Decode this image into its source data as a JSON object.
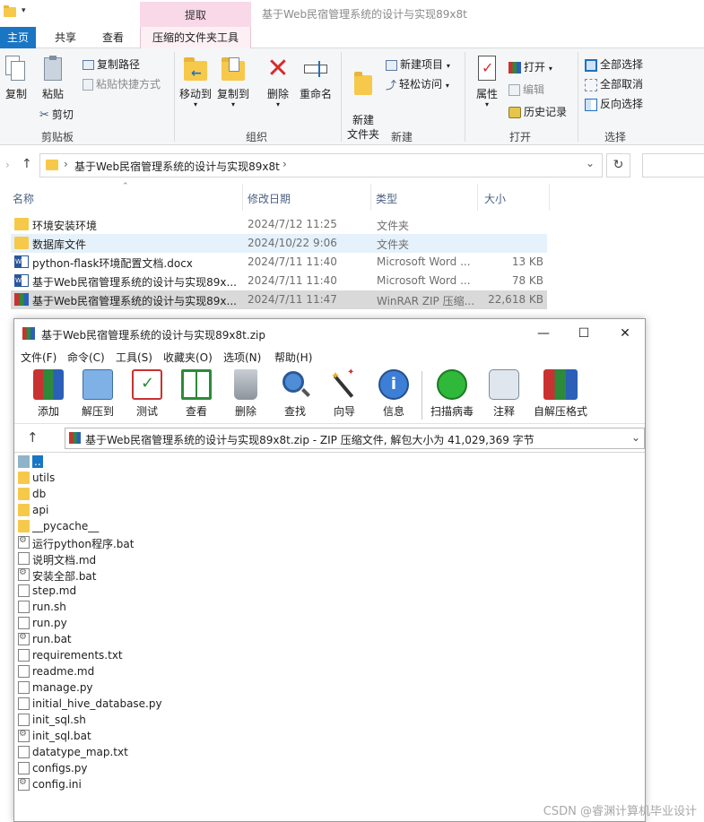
{
  "explorer": {
    "title_context_tab": "提取",
    "window_title": "基于Web民宿管理系统的设计与实现89x8t",
    "tabs": [
      "主页",
      "共享",
      "查看",
      "压缩的文件夹工具"
    ],
    "ribbon": {
      "clipboard": {
        "label": "剪贴板",
        "copy": "复制",
        "paste": "粘贴",
        "copy_path": "复制路径",
        "paste_shortcut": "粘贴快捷方式",
        "cut": "剪切"
      },
      "organize": {
        "label": "组织",
        "move_to": "移动到",
        "copy_to": "复制到",
        "delete": "删除",
        "rename": "重命名"
      },
      "new": {
        "label": "新建",
        "new_folder": "新建\n文件夹",
        "new_item": "新建项目",
        "easy_access": "轻松访问"
      },
      "open": {
        "label": "打开",
        "properties": "属性",
        "open": "打开",
        "edit": "编辑",
        "history": "历史记录"
      },
      "select": {
        "label": "选择",
        "select_all": "全部选择",
        "select_none": "全部取消",
        "invert": "反向选择"
      }
    },
    "address": {
      "path": "基于Web民宿管理系统的设计与实现89x8t"
    },
    "columns": {
      "name": "名称",
      "date": "修改日期",
      "type": "类型",
      "size": "大小"
    },
    "files": [
      {
        "name": "环境安装环境",
        "date": "2024/7/12 11:25",
        "type": "文件夹",
        "size": "",
        "icon": "folder-icon"
      },
      {
        "name": "数据库文件",
        "date": "2024/10/22 9:06",
        "type": "文件夹",
        "size": "",
        "icon": "folder-icon"
      },
      {
        "name": "python-flask环境配置文档.docx",
        "date": "2024/7/11 11:40",
        "type": "Microsoft Word ...",
        "size": "13 KB",
        "icon": "word-icon"
      },
      {
        "name": "基于Web民宿管理系统的设计与实现89x...",
        "date": "2024/7/11 11:40",
        "type": "Microsoft Word ...",
        "size": "78 KB",
        "icon": "word-icon"
      },
      {
        "name": "基于Web民宿管理系统的设计与实现89x...",
        "date": "2024/7/11 11:47",
        "type": "WinRAR ZIP 压缩...",
        "size": "22,618 KB",
        "icon": "winrar-icon"
      }
    ]
  },
  "winrar": {
    "title": "基于Web民宿管理系统的设计与实现89x8t.zip",
    "menu": [
      "文件(F)",
      "命令(C)",
      "工具(S)",
      "收藏夹(O)",
      "选项(N)",
      "帮助(H)"
    ],
    "tools": [
      "添加",
      "解压到",
      "测试",
      "查看",
      "删除",
      "查找",
      "向导",
      "信息",
      "扫描病毒",
      "注释",
      "自解压格式"
    ],
    "path": "基于Web民宿管理系统的设计与实现89x8t.zip - ZIP 压缩文件, 解包大小为 41,029,369 字节",
    "items": [
      {
        "name": "..",
        "kind": "up"
      },
      {
        "name": "utils",
        "kind": "folder"
      },
      {
        "name": "db",
        "kind": "folder"
      },
      {
        "name": "api",
        "kind": "folder"
      },
      {
        "name": "__pycache__",
        "kind": "folder"
      },
      {
        "name": "运行python程序.bat",
        "kind": "bat"
      },
      {
        "name": "说明文档.md",
        "kind": "file"
      },
      {
        "name": "安装全部.bat",
        "kind": "bat"
      },
      {
        "name": "step.md",
        "kind": "file"
      },
      {
        "name": "run.sh",
        "kind": "file"
      },
      {
        "name": "run.py",
        "kind": "file"
      },
      {
        "name": "run.bat",
        "kind": "bat"
      },
      {
        "name": "requirements.txt",
        "kind": "file"
      },
      {
        "name": "readme.md",
        "kind": "file"
      },
      {
        "name": "manage.py",
        "kind": "file"
      },
      {
        "name": "initial_hive_database.py",
        "kind": "file"
      },
      {
        "name": "init_sql.sh",
        "kind": "file"
      },
      {
        "name": "init_sql.bat",
        "kind": "bat"
      },
      {
        "name": "datatype_map.txt",
        "kind": "file"
      },
      {
        "name": "configs.py",
        "kind": "file"
      },
      {
        "name": "config.ini",
        "kind": "bat"
      }
    ]
  },
  "watermark": "CSDN @睿渊计算机毕业设计",
  "colors": {
    "accent": "#1976c4",
    "context_tab": "#f9d8e7",
    "selected_row": "#e5f1fb",
    "folder": "#f6c94a"
  }
}
